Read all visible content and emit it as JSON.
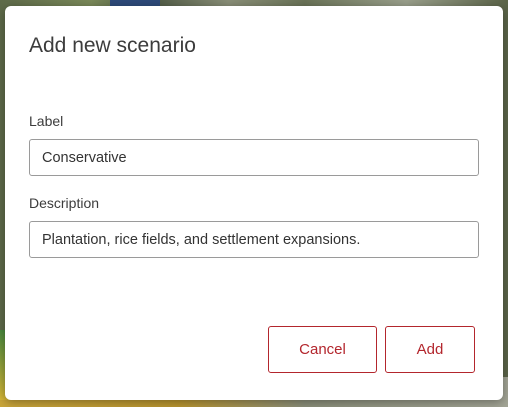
{
  "dialog": {
    "title": "Add new scenario",
    "label_field": {
      "label": "Label",
      "value": "Conservative"
    },
    "description_field": {
      "label": "Description",
      "value": "Plantation, rice fields, and settlement expansions."
    },
    "buttons": {
      "cancel": "Cancel",
      "add": "Add"
    }
  },
  "colors": {
    "accent": "#b3262d",
    "text": "#3c3c3c",
    "input_border": "#9a9a9a"
  }
}
